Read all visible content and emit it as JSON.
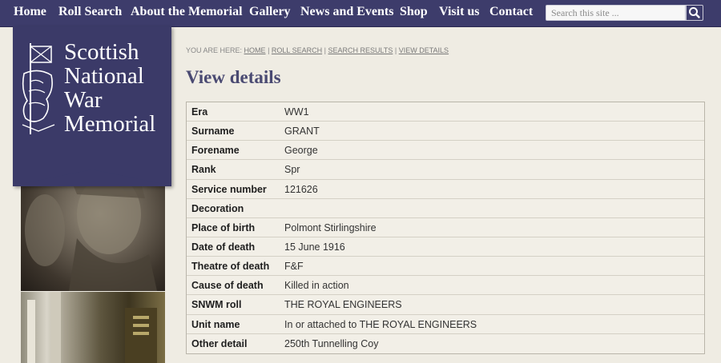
{
  "nav": {
    "items": [
      "Home",
      "Roll Search",
      "About the Memorial",
      "Gallery",
      "News and Events",
      "Shop",
      "Visit us",
      "Contact"
    ],
    "search_placeholder": "Search this site ..."
  },
  "sidebar": {
    "logo_text": "Scottish\nNational\nWar\nMemorial"
  },
  "breadcrumb": {
    "prefix": "YOU ARE HERE:",
    "items": [
      "HOME",
      "ROLL SEARCH",
      "SEARCH RESULTS",
      "VIEW DETAILS"
    ],
    "separator": "|"
  },
  "page_title": "View details",
  "details": [
    {
      "label": "Era",
      "value": "WW1"
    },
    {
      "label": "Surname",
      "value": "GRANT"
    },
    {
      "label": "Forename",
      "value": "George"
    },
    {
      "label": "Rank",
      "value": "Spr"
    },
    {
      "label": "Service number",
      "value": "121626"
    },
    {
      "label": "Decoration",
      "value": ""
    },
    {
      "label": "Place of birth",
      "value": "Polmont Stirlingshire"
    },
    {
      "label": "Date of death",
      "value": "15 June 1916"
    },
    {
      "label": "Theatre of death",
      "value": "F&F"
    },
    {
      "label": "Cause of death",
      "value": "Killed in action"
    },
    {
      "label": "SNWM roll",
      "value": "THE ROYAL ENGINEERS"
    },
    {
      "label": "Unit name",
      "value": "In or attached to THE ROYAL ENGINEERS"
    },
    {
      "label": "Other detail",
      "value": "250th Tunnelling Coy"
    }
  ],
  "colors": {
    "nav_bg": "#3d3c6b",
    "banner_bg": "#3b3a68",
    "page_bg": "#efece3",
    "title": "#4a4a72"
  },
  "icons": {
    "search": "search-icon",
    "crest": "crest-icon"
  }
}
